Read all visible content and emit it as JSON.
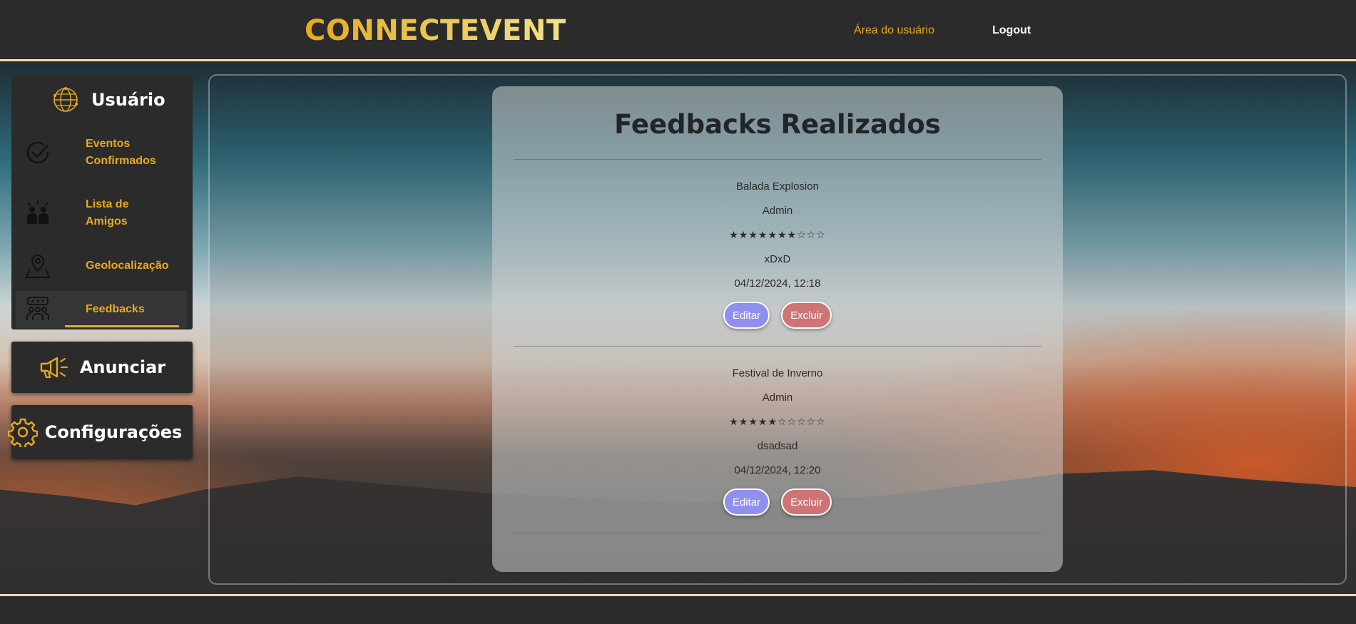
{
  "header": {
    "brand": "CONNECTEVENT",
    "nav": {
      "user_area": "Área do usuário",
      "logout": "Logout"
    }
  },
  "sidebar": {
    "title": "Usuário",
    "items": [
      {
        "label": "Eventos Confirmados",
        "icon": "check-circle-icon"
      },
      {
        "label": "Lista de Amigos",
        "icon": "friends-icon"
      },
      {
        "label": "Geolocalização",
        "icon": "map-pin-icon"
      },
      {
        "label": "Feedbacks",
        "icon": "feedback-group-icon",
        "active": true
      }
    ],
    "announce": "Anunciar",
    "settings": "Configurações"
  },
  "main": {
    "title": "Feedbacks Realizados",
    "feedbacks": [
      {
        "event": "Balada Explosion",
        "author": "Admin",
        "rating": 7,
        "max_rating": 10,
        "stars_text": "★★★★★★★☆☆☆",
        "comment": "xDxD",
        "date": "04/12/2024, 12:18",
        "edit_label": "Editar",
        "delete_label": "Excluir"
      },
      {
        "event": "Festival de Inverno",
        "author": "Admin",
        "rating": 5,
        "max_rating": 10,
        "stars_text": "★★★★★☆☆☆☆☆",
        "comment": "dsadsad",
        "date": "04/12/2024, 12:20",
        "edit_label": "Editar",
        "delete_label": "Excluir"
      }
    ]
  },
  "colors": {
    "accent": "#e8a91e",
    "edit_button": "#8f8ff0",
    "delete_button": "#cf7474"
  }
}
